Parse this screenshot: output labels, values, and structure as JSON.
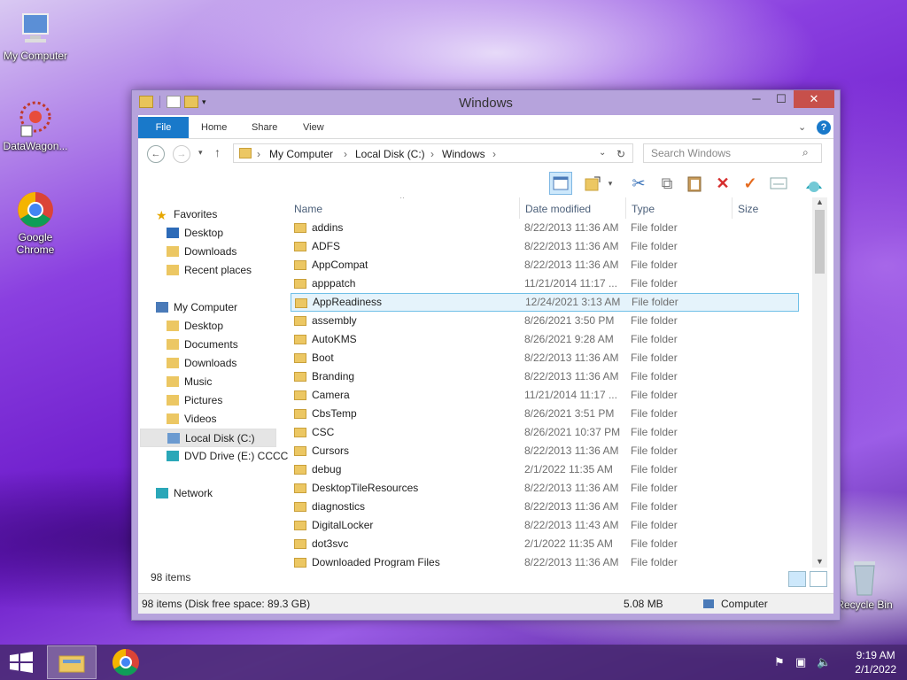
{
  "desktop": {
    "icons": [
      {
        "label": "My Computer",
        "icon": "computer-icon"
      },
      {
        "label": "DataWagon...",
        "icon": "datawagon-icon"
      },
      {
        "label": "Google Chrome",
        "icon": "chrome-icon"
      },
      {
        "label": "Recycle Bin",
        "icon": "recycle-bin-icon"
      }
    ]
  },
  "window": {
    "title": "Windows",
    "controls": {
      "minimize": "─",
      "maximize": "☐",
      "close": "✕"
    },
    "ribbon_tabs": [
      "File",
      "Home",
      "Share",
      "View"
    ],
    "help": "?",
    "address": {
      "segments": [
        "My Computer",
        "Local Disk (C:)",
        "Windows"
      ]
    },
    "search": {
      "placeholder": "Search Windows"
    },
    "nav_pane": {
      "favorites": {
        "label": "Favorites",
        "items": [
          "Desktop",
          "Downloads",
          "Recent places"
        ]
      },
      "computer": {
        "label": "My Computer",
        "items": [
          "Desktop",
          "Documents",
          "Downloads",
          "Music",
          "Pictures",
          "Videos",
          "Local Disk (C:)",
          "DVD Drive (E:) CCCC"
        ]
      },
      "network": {
        "label": "Network"
      }
    },
    "columns": {
      "name": "Name",
      "date": "Date modified",
      "type": "Type",
      "size": "Size"
    },
    "rows": [
      {
        "name": "addins",
        "date": "8/22/2013 11:36 AM",
        "type": "File folder"
      },
      {
        "name": "ADFS",
        "date": "8/22/2013 11:36 AM",
        "type": "File folder"
      },
      {
        "name": "AppCompat",
        "date": "8/22/2013 11:36 AM",
        "type": "File folder"
      },
      {
        "name": "apppatch",
        "date": "11/21/2014 11:17 ...",
        "type": "File folder"
      },
      {
        "name": "AppReadiness",
        "date": "12/24/2021 3:13 AM",
        "type": "File folder",
        "selected": true
      },
      {
        "name": "assembly",
        "date": "8/26/2021 3:50 PM",
        "type": "File folder"
      },
      {
        "name": "AutoKMS",
        "date": "8/26/2021 9:28 AM",
        "type": "File folder"
      },
      {
        "name": "Boot",
        "date": "8/22/2013 11:36 AM",
        "type": "File folder"
      },
      {
        "name": "Branding",
        "date": "8/22/2013 11:36 AM",
        "type": "File folder"
      },
      {
        "name": "Camera",
        "date": "11/21/2014 11:17 ...",
        "type": "File folder"
      },
      {
        "name": "CbsTemp",
        "date": "8/26/2021 3:51 PM",
        "type": "File folder"
      },
      {
        "name": "CSC",
        "date": "8/26/2021 10:37 PM",
        "type": "File folder"
      },
      {
        "name": "Cursors",
        "date": "8/22/2013 11:36 AM",
        "type": "File folder"
      },
      {
        "name": "debug",
        "date": "2/1/2022 11:35 AM",
        "type": "File folder"
      },
      {
        "name": "DesktopTileResources",
        "date": "8/22/2013 11:36 AM",
        "type": "File folder"
      },
      {
        "name": "diagnostics",
        "date": "8/22/2013 11:36 AM",
        "type": "File folder"
      },
      {
        "name": "DigitalLocker",
        "date": "8/22/2013 11:43 AM",
        "type": "File folder"
      },
      {
        "name": "dot3svc",
        "date": "2/1/2022 11:35 AM",
        "type": "File folder"
      },
      {
        "name": "Downloaded Program Files",
        "date": "8/22/2013 11:36 AM",
        "type": "File folder"
      }
    ],
    "item_count": "98 items",
    "status": {
      "left": "98 items (Disk free space: 89.3 GB)",
      "size": "5.08 MB",
      "location": "Computer"
    }
  },
  "taskbar": {
    "time": "9:19 AM",
    "date": "2/1/2022"
  },
  "colors": {
    "accent": "#1979ca",
    "selection": "#e5f3fb",
    "folder": "#ecc763"
  }
}
